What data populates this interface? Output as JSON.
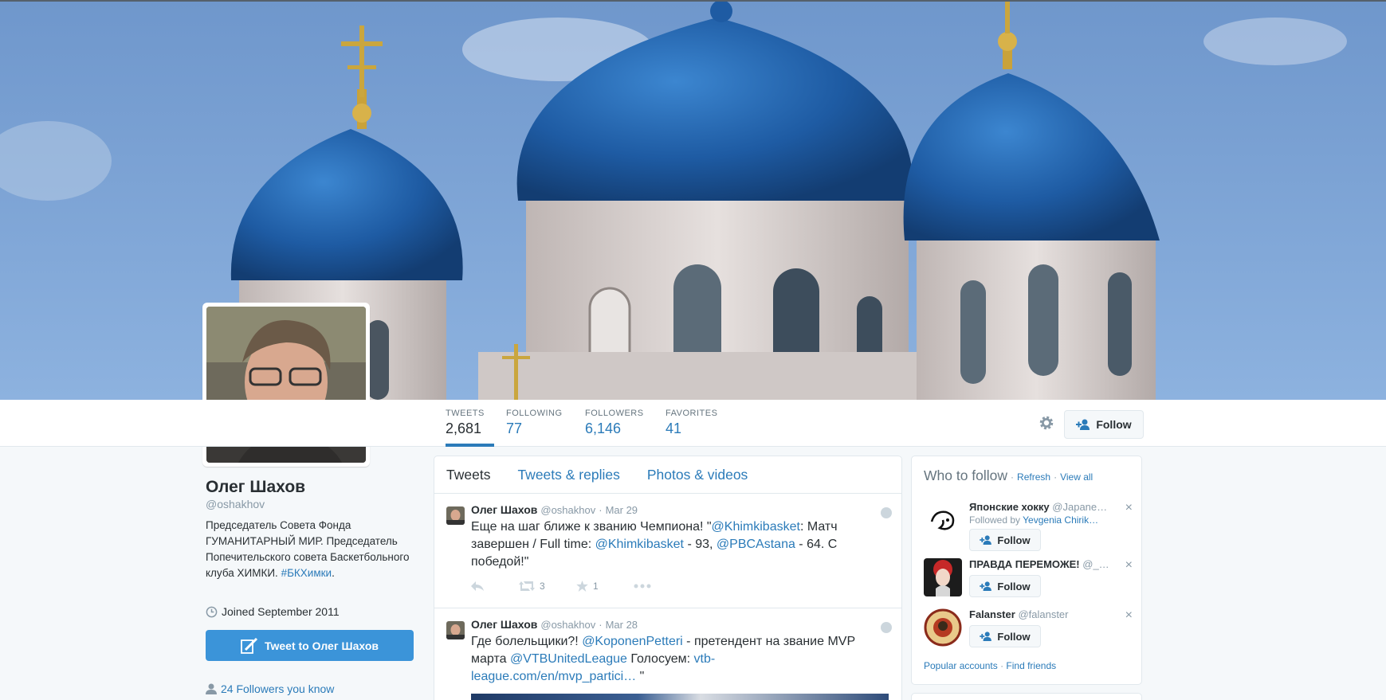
{
  "profile": {
    "name": "Олег Шахов",
    "handle": "@oshakhov",
    "bio_text": "Председатель Совета Фонда ГУМАНИТАРНЫЙ МИР. Председатель Попечительского совета Баскетбольного клуба ХИМКИ.",
    "bio_hashtag": "#БКХимки",
    "bio_end": ".",
    "joined": "Joined September 2011",
    "tweet_to_label": "Tweet to Олег Шахов",
    "followers_you_know": "24 Followers you know"
  },
  "stats": [
    {
      "label": "TWEETS",
      "value": "2,681"
    },
    {
      "label": "FOLLOWING",
      "value": "77"
    },
    {
      "label": "FOLLOWERS",
      "value": "6,146"
    },
    {
      "label": "FAVORITES",
      "value": "41"
    }
  ],
  "follow_label": "Follow",
  "icons": {
    "gear": "gear-icon",
    "follow": "add-user-icon",
    "quill": "quill-icon",
    "clock": "clock-icon",
    "person": "person-icon"
  },
  "timeline": {
    "tabs": [
      "Tweets",
      "Tweets & replies",
      "Photos & videos"
    ],
    "tweets": [
      {
        "author": "Олег Шахов",
        "handle": "@oshakhov",
        "sep": "·",
        "date": "Mar 29",
        "text_parts": {
          "a": "Еще на шаг ближе к званию Чемпиона! \"",
          "m1": "@Khimkibasket",
          "b": ": Матч завершен / Full time: ",
          "m2": "@Khimkibasket",
          "c": " - 93, ",
          "m3": "@PBCAstana",
          "d": " - 64. С победой!\""
        },
        "retweets": "3",
        "favorites": "1"
      },
      {
        "author": "Олег Шахов",
        "handle": "@oshakhov",
        "sep": "·",
        "date": "Mar 28",
        "text_parts": {
          "a": "Где болельщики?! ",
          "m1": "@KoponenPetteri",
          "b": " - претендент на звание MVP марта ",
          "m2": "@VTBUnitedLeague",
          "c": " Голосуем: ",
          "m3": "vtb-league.com/en/mvp_partici…",
          "d": " \""
        }
      }
    ]
  },
  "who_to_follow": {
    "title": "Who to follow",
    "dot": "·",
    "refresh": "Refresh",
    "view_all": "View all",
    "items": [
      {
        "name": "Японские хокку",
        "handle": "@Japane…",
        "sub_prefix": "Followed by",
        "sub_link": "Yevgenia Chirik…",
        "follow": "Follow"
      },
      {
        "name": "ПРАВДА ПЕРЕМОЖЕ!",
        "handle": "@_…",
        "follow": "Follow"
      },
      {
        "name": "Falanster",
        "handle": "@falanster",
        "follow": "Follow"
      }
    ],
    "close": "×",
    "popular": "Popular accounts",
    "find": "Find friends"
  },
  "colors": {
    "link": "#2b7bb9",
    "button_blue": "#3b94d9",
    "dome_blue": "#1f5fa8",
    "sky": "#7fa8d6"
  }
}
